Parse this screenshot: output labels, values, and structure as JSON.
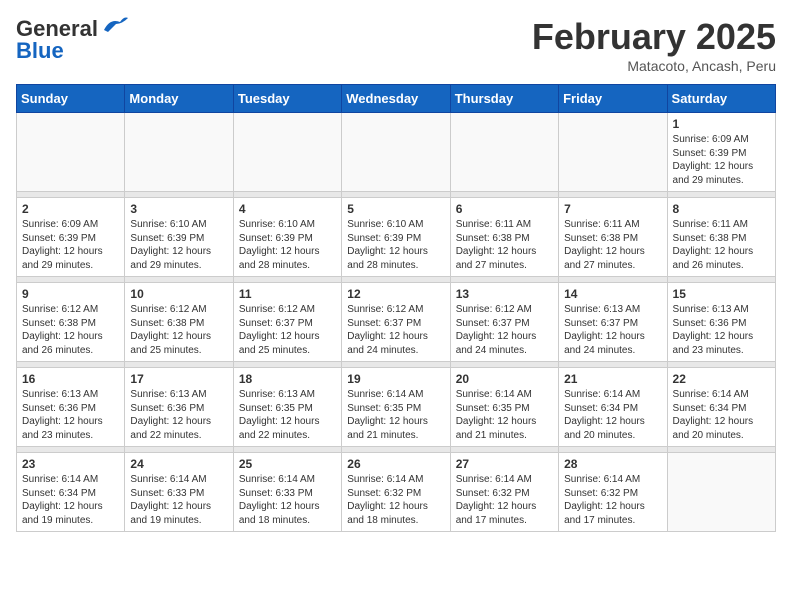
{
  "header": {
    "logo_general": "General",
    "logo_blue": "Blue",
    "month": "February 2025",
    "location": "Matacoto, Ancash, Peru"
  },
  "weekdays": [
    "Sunday",
    "Monday",
    "Tuesday",
    "Wednesday",
    "Thursday",
    "Friday",
    "Saturday"
  ],
  "weeks": [
    [
      {
        "day": "",
        "info": ""
      },
      {
        "day": "",
        "info": ""
      },
      {
        "day": "",
        "info": ""
      },
      {
        "day": "",
        "info": ""
      },
      {
        "day": "",
        "info": ""
      },
      {
        "day": "",
        "info": ""
      },
      {
        "day": "1",
        "info": "Sunrise: 6:09 AM\nSunset: 6:39 PM\nDaylight: 12 hours and 29 minutes."
      }
    ],
    [
      {
        "day": "2",
        "info": "Sunrise: 6:09 AM\nSunset: 6:39 PM\nDaylight: 12 hours and 29 minutes."
      },
      {
        "day": "3",
        "info": "Sunrise: 6:10 AM\nSunset: 6:39 PM\nDaylight: 12 hours and 29 minutes."
      },
      {
        "day": "4",
        "info": "Sunrise: 6:10 AM\nSunset: 6:39 PM\nDaylight: 12 hours and 28 minutes."
      },
      {
        "day": "5",
        "info": "Sunrise: 6:10 AM\nSunset: 6:39 PM\nDaylight: 12 hours and 28 minutes."
      },
      {
        "day": "6",
        "info": "Sunrise: 6:11 AM\nSunset: 6:38 PM\nDaylight: 12 hours and 27 minutes."
      },
      {
        "day": "7",
        "info": "Sunrise: 6:11 AM\nSunset: 6:38 PM\nDaylight: 12 hours and 27 minutes."
      },
      {
        "day": "8",
        "info": "Sunrise: 6:11 AM\nSunset: 6:38 PM\nDaylight: 12 hours and 26 minutes."
      }
    ],
    [
      {
        "day": "9",
        "info": "Sunrise: 6:12 AM\nSunset: 6:38 PM\nDaylight: 12 hours and 26 minutes."
      },
      {
        "day": "10",
        "info": "Sunrise: 6:12 AM\nSunset: 6:38 PM\nDaylight: 12 hours and 25 minutes."
      },
      {
        "day": "11",
        "info": "Sunrise: 6:12 AM\nSunset: 6:37 PM\nDaylight: 12 hours and 25 minutes."
      },
      {
        "day": "12",
        "info": "Sunrise: 6:12 AM\nSunset: 6:37 PM\nDaylight: 12 hours and 24 minutes."
      },
      {
        "day": "13",
        "info": "Sunrise: 6:12 AM\nSunset: 6:37 PM\nDaylight: 12 hours and 24 minutes."
      },
      {
        "day": "14",
        "info": "Sunrise: 6:13 AM\nSunset: 6:37 PM\nDaylight: 12 hours and 24 minutes."
      },
      {
        "day": "15",
        "info": "Sunrise: 6:13 AM\nSunset: 6:36 PM\nDaylight: 12 hours and 23 minutes."
      }
    ],
    [
      {
        "day": "16",
        "info": "Sunrise: 6:13 AM\nSunset: 6:36 PM\nDaylight: 12 hours and 23 minutes."
      },
      {
        "day": "17",
        "info": "Sunrise: 6:13 AM\nSunset: 6:36 PM\nDaylight: 12 hours and 22 minutes."
      },
      {
        "day": "18",
        "info": "Sunrise: 6:13 AM\nSunset: 6:35 PM\nDaylight: 12 hours and 22 minutes."
      },
      {
        "day": "19",
        "info": "Sunrise: 6:14 AM\nSunset: 6:35 PM\nDaylight: 12 hours and 21 minutes."
      },
      {
        "day": "20",
        "info": "Sunrise: 6:14 AM\nSunset: 6:35 PM\nDaylight: 12 hours and 21 minutes."
      },
      {
        "day": "21",
        "info": "Sunrise: 6:14 AM\nSunset: 6:34 PM\nDaylight: 12 hours and 20 minutes."
      },
      {
        "day": "22",
        "info": "Sunrise: 6:14 AM\nSunset: 6:34 PM\nDaylight: 12 hours and 20 minutes."
      }
    ],
    [
      {
        "day": "23",
        "info": "Sunrise: 6:14 AM\nSunset: 6:34 PM\nDaylight: 12 hours and 19 minutes."
      },
      {
        "day": "24",
        "info": "Sunrise: 6:14 AM\nSunset: 6:33 PM\nDaylight: 12 hours and 19 minutes."
      },
      {
        "day": "25",
        "info": "Sunrise: 6:14 AM\nSunset: 6:33 PM\nDaylight: 12 hours and 18 minutes."
      },
      {
        "day": "26",
        "info": "Sunrise: 6:14 AM\nSunset: 6:32 PM\nDaylight: 12 hours and 18 minutes."
      },
      {
        "day": "27",
        "info": "Sunrise: 6:14 AM\nSunset: 6:32 PM\nDaylight: 12 hours and 17 minutes."
      },
      {
        "day": "28",
        "info": "Sunrise: 6:14 AM\nSunset: 6:32 PM\nDaylight: 12 hours and 17 minutes."
      },
      {
        "day": "",
        "info": ""
      }
    ]
  ]
}
